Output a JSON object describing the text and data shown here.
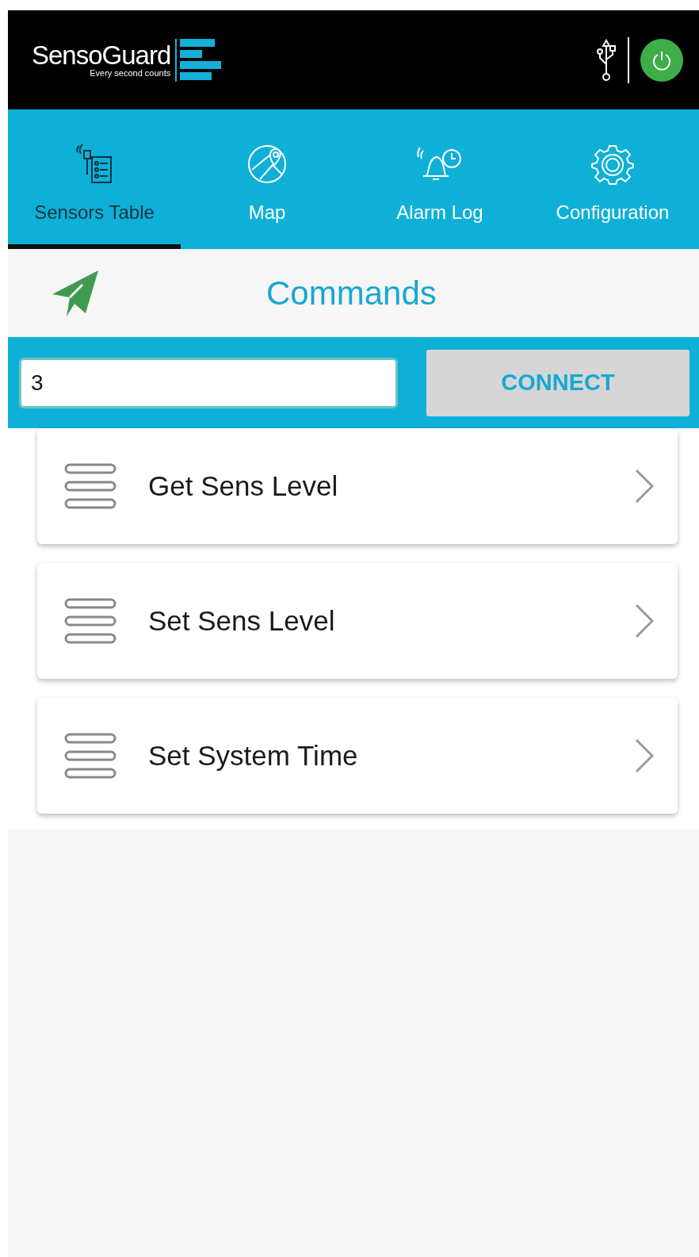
{
  "header": {
    "brand": "SensoGuard",
    "tagline": "Every second counts",
    "power_on": true
  },
  "tabs": [
    {
      "label": "Sensors Table",
      "kind": "sensors",
      "selected": true
    },
    {
      "label": "Map",
      "kind": "map",
      "selected": false
    },
    {
      "label": "Alarm Log",
      "kind": "alarm",
      "selected": false
    },
    {
      "label": "Configuration",
      "kind": "gear",
      "selected": false
    }
  ],
  "page_title": "Commands",
  "connect": {
    "value": "3",
    "button": "CONNECT"
  },
  "commands": [
    {
      "label": "Get Sens Level"
    },
    {
      "label": "Set Sens Level"
    },
    {
      "label": "Set System Time"
    }
  ]
}
